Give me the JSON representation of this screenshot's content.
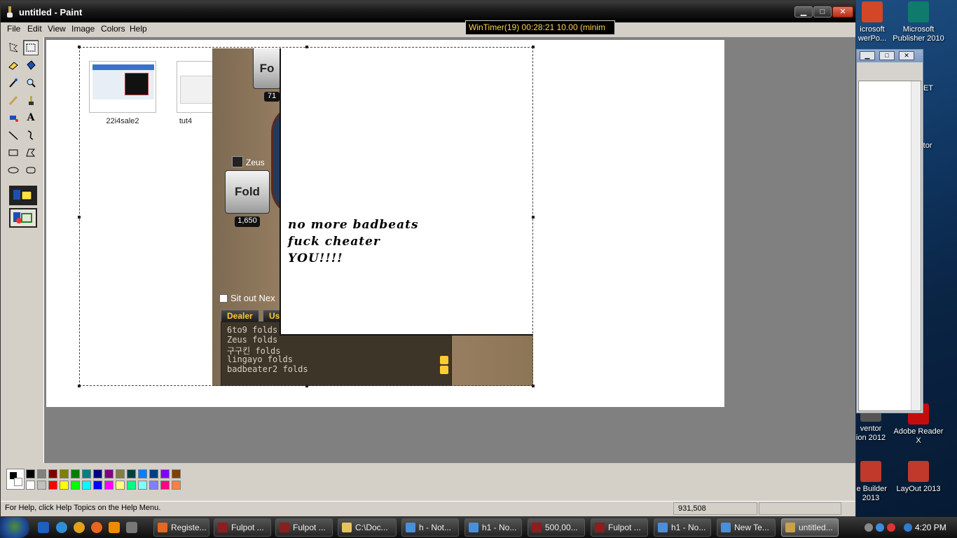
{
  "window": {
    "title": "untitled - Paint",
    "min_label": "▁",
    "max_label": "□",
    "close_label": "✕"
  },
  "menu": [
    "File",
    "Edit",
    "View",
    "Image",
    "Colors",
    "Help"
  ],
  "wintimer": "WinTimer(19)  00:28:21  10.00 (minim",
  "canvas": {
    "thumbnails": [
      {
        "label": "22i4sale2"
      },
      {
        "label": "tut4"
      }
    ],
    "poker": {
      "fold_top_label": "Fo",
      "chip_top": "71",
      "player_name": "Zeus",
      "fold_label": "Fold",
      "chip_amount": "1,650",
      "sitout_label": "Sit out Nex",
      "tab_dealer": "Dealer",
      "tab_user": "Us",
      "chat": [
        "6to9 folds",
        "Zeus folds",
        "구구킨 folds",
        "lingayo folds",
        "badbeater2 folds"
      ]
    },
    "scrawl": [
      "no more badbeats",
      "fuck cheater",
      "YOU!!!!"
    ]
  },
  "palette": [
    "#000000",
    "#808080",
    "#800000",
    "#808000",
    "#008000",
    "#008080",
    "#000080",
    "#800080",
    "#808040",
    "#004040",
    "#0080ff",
    "#004080",
    "#8000ff",
    "#804000",
    "#ffffff",
    "#c0c0c0",
    "#ff0000",
    "#ffff00",
    "#00ff00",
    "#00ffff",
    "#0000ff",
    "#ff00ff",
    "#ffff80",
    "#00ff80",
    "#80ffff",
    "#8080ff",
    "#ff0080",
    "#ff8040"
  ],
  "status": {
    "help": "For Help, click Help Topics on the Help Menu.",
    "coords": "931,508"
  },
  "desktop_icons": [
    {
      "label": "icrosoft\nwerPo...",
      "color": "#d24726"
    },
    {
      "label": "Microsoft\nPublisher 2010",
      "color": "#0f7b6c"
    },
    {
      "label": "NET",
      "color": "#444"
    },
    {
      "label": "ator",
      "color": "#333"
    },
    {
      "label": "ventor\nion 2012",
      "color": "#555"
    },
    {
      "label": "Adobe Reader\nX",
      "color": "#c40c0c"
    },
    {
      "label": "le Builder\n2013",
      "color": "#c0392b"
    },
    {
      "label": "LayOut 2013",
      "color": "#c0392b"
    }
  ],
  "taskbar": {
    "tasks": [
      "Registe...",
      "Fulpot ...",
      "Fulpot ...",
      "C:\\Doc...",
      "h - Not...",
      "h1 - No...",
      "500,00...",
      "Fulpot ...",
      "h1 - No...",
      "New Te...",
      "untitled..."
    ],
    "clock": "4:20 PM"
  }
}
